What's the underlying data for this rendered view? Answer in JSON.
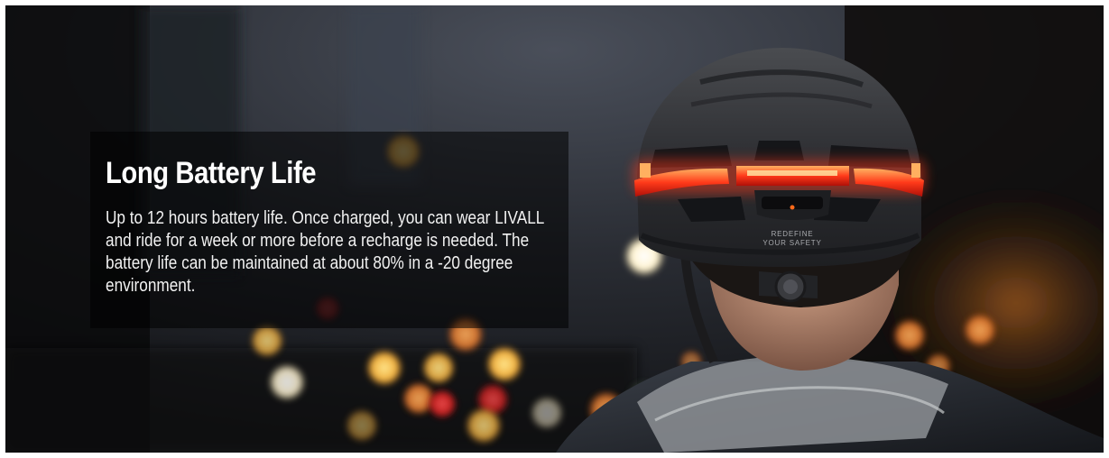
{
  "feature": {
    "title": "Long Battery Life",
    "description": "Up to 12 hours battery life. Once charged, you can wear LIVALL and ride for a week or more before a recharge is needed. The battery life can be maintained at about 80% in a -20 degree environment."
  },
  "helmet": {
    "printed_text_line1": "REDEFINE",
    "printed_text_line2": "YOUR SAFETY"
  },
  "colors": {
    "overlay": "#000000",
    "text": "#ffffff",
    "taillight": "#ff3a1a",
    "helmet": "#2b2c2f"
  }
}
